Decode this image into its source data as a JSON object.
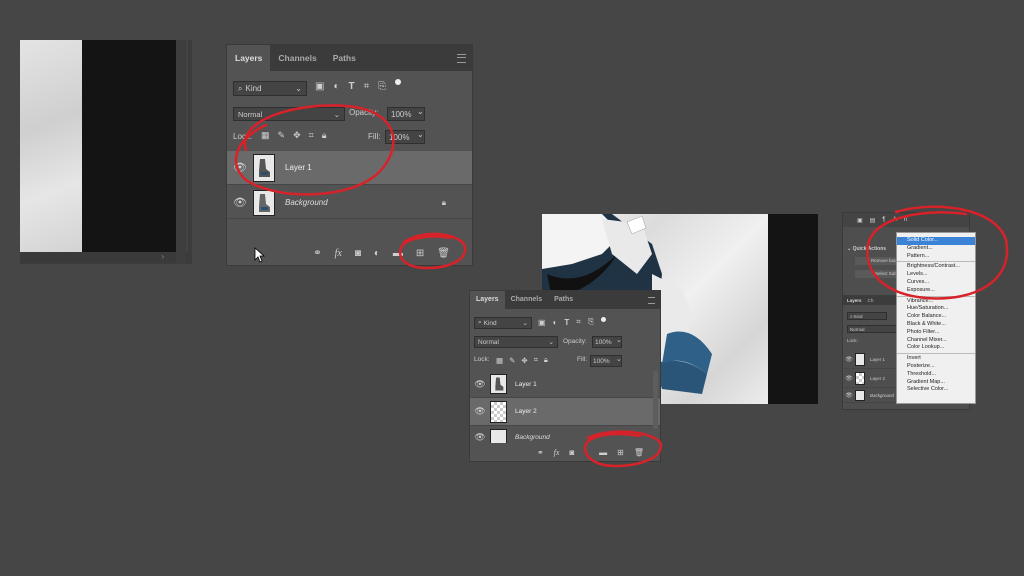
{
  "panel_main": {
    "tabs": [
      "Layers",
      "Channels",
      "Paths"
    ],
    "filter_kind": "Kind",
    "blend_mode": "Normal",
    "opacity_label": "Opacity:",
    "opacity_value": "100%",
    "lock_label": "Lock:",
    "fill_label": "Fill:",
    "fill_value": "100%",
    "layers": [
      {
        "name": "Layer 1"
      },
      {
        "name": "Background"
      }
    ]
  },
  "panel_second": {
    "tabs": [
      "Layers",
      "Channels",
      "Paths"
    ],
    "filter_kind": "Kind",
    "blend_mode": "Normal",
    "opacity_label": "Opacity:",
    "opacity_value": "100%",
    "lock_label": "Lock:",
    "fill_label": "Fill:",
    "fill_value": "100%",
    "layers": [
      {
        "name": "Layer 1"
      },
      {
        "name": "Layer 2"
      },
      {
        "name": "Background"
      }
    ]
  },
  "panel_third": {
    "quick_actions": "Quick Actions",
    "remove_bg": "Remove back",
    "select_subject": "Select Sub",
    "tabs": [
      "Layers",
      "Ch"
    ],
    "filter_kind": "Kind",
    "blend_mode": "Normal",
    "lock_label": "Lock:",
    "layers": [
      "Layer 1",
      "Layer 2",
      "Background"
    ]
  },
  "adjustment_menu": {
    "items": [
      "Solid Color...",
      "Gradient...",
      "Pattern...",
      "---",
      "Brightness/Contrast...",
      "Levels...",
      "Curves...",
      "Exposure...",
      "---",
      "Vibrance...",
      "Hue/Saturation...",
      "Color Balance...",
      "Black & White...",
      "Photo Filter...",
      "Channel Mixer...",
      "Color Lookup...",
      "---",
      "Invert",
      "Posterize...",
      "Threshold...",
      "Gradient Map...",
      "Selective Color..."
    ],
    "highlighted": "Solid Color..."
  },
  "colors": {
    "background": "#464646",
    "panel": "#535353",
    "annotation_red": "#d8222a",
    "highlight_blue": "#3b83d6"
  }
}
